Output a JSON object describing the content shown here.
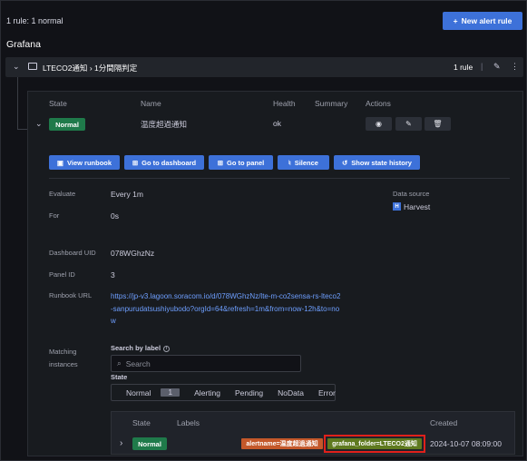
{
  "header": {
    "rule_count_label": "1 rule:",
    "rule_count_value": "1 normal",
    "new_alert_rule_label": "New alert rule"
  },
  "section_title": "Grafana",
  "folder": {
    "name": "LTECO2通知",
    "group": "1分間隔判定",
    "rule_count": "1 rule",
    "separator": "|"
  },
  "table": {
    "headers": {
      "state": "State",
      "name": "Name",
      "health": "Health",
      "summary": "Summary",
      "actions": "Actions"
    },
    "row": {
      "state": "Normal",
      "name": "温度超過通知",
      "health": "ok"
    }
  },
  "buttons": {
    "view_runbook": "View runbook",
    "go_to_dashboard": "Go to dashboard",
    "go_to_panel": "Go to panel",
    "silence": "Silence",
    "show_state_history": "Show state history"
  },
  "details": {
    "evaluate_label": "Evaluate",
    "evaluate_value": "Every 1m",
    "for_label": "For",
    "for_value": "0s",
    "dashboard_uid_label": "Dashboard UID",
    "dashboard_uid_value": "078WGhzNz",
    "panel_id_label": "Panel ID",
    "panel_id_value": "3",
    "runbook_url_label": "Runbook URL",
    "runbook_url_value": "https://jp-v3.lagoon.soracom.io/d/078WGhzNz/lte-m-co2sensa-rs-lteco2-sanpurudatsushiyubodo?orgId=64&refresh=1m&from=now-12h&to=now",
    "data_source_label": "Data source",
    "data_source_value": "Harvest"
  },
  "matching": {
    "label": "Matching instances",
    "search_by_label": "Search by label",
    "search_placeholder": "Search",
    "state_label": "State",
    "filters": [
      "Normal",
      "Alerting",
      "Pending",
      "NoData",
      "Error"
    ],
    "normal_count": "1",
    "instance_headers": {
      "state": "State",
      "labels": "Labels",
      "created": "Created"
    },
    "instance": {
      "state": "Normal",
      "label_alertname": "alertname=温度超過通知",
      "label_folder": "grafana_folder=LTECO2通知",
      "created": "2024-10-07 08:09:00"
    }
  },
  "colors": {
    "accent": "#3d71d9",
    "normal_green": "#1f7a4a",
    "label_orange": "#c4582a",
    "label_olive": "#5f7a1f",
    "highlight_red": "#e0201b"
  }
}
